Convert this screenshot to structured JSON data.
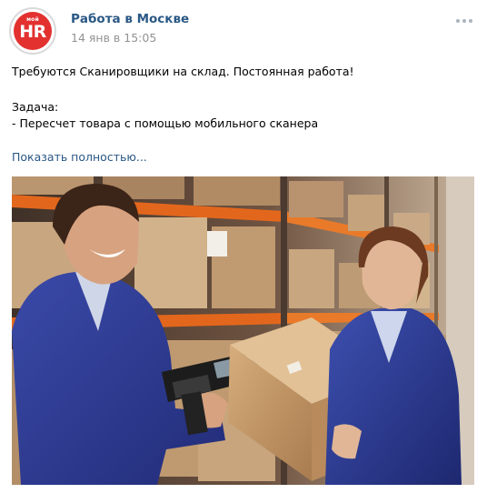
{
  "post": {
    "author": "Работа в Москве",
    "date": "14 янв в 15:05",
    "avatar": {
      "small_text": "мой",
      "big_text": "HR",
      "color": "#e2312f"
    },
    "lines": [
      "Требуются Сканировщики на склад. Постоянная работа!",
      "Задача:",
      "- Пересчет товара с помощью мобильного сканера"
    ],
    "show_more_label": "Показать полностью...",
    "more_icon": "ellipsis-icon"
  },
  "colors": {
    "link": "#2a5885",
    "meta": "#939393",
    "menu_dots": "#aab4bf"
  }
}
